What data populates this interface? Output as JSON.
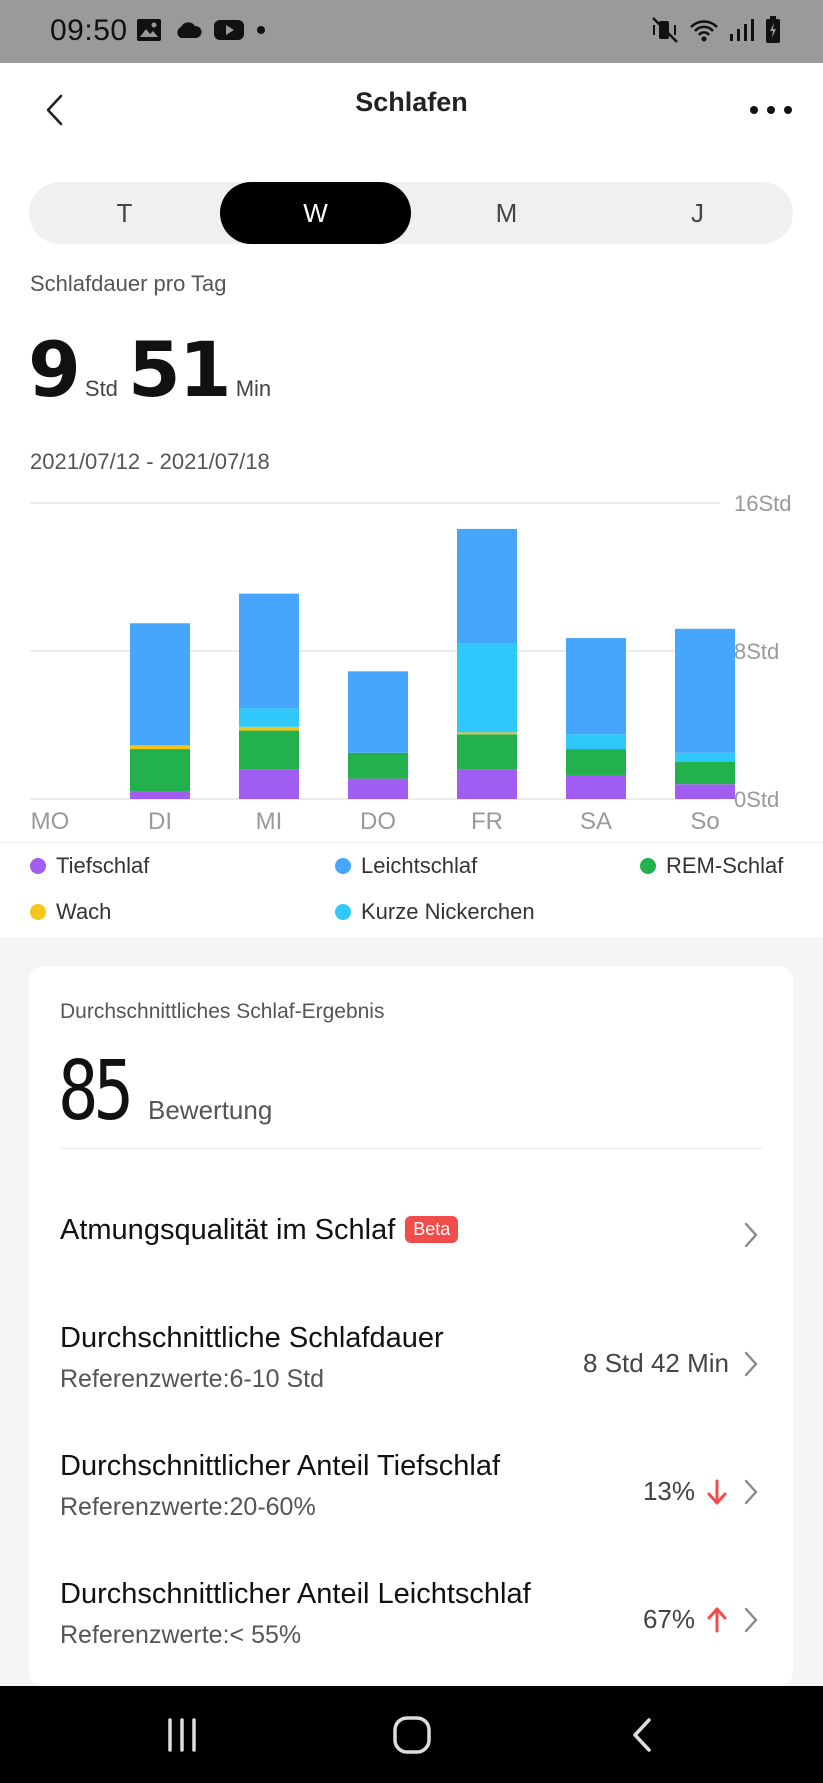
{
  "status_bar": {
    "time": "09:50",
    "left_icons": [
      "image-icon",
      "cloud-icon",
      "youtube-icon",
      "dot-icon"
    ],
    "right_icons": [
      "mute-vibrate-icon",
      "wifi-icon",
      "signal-icon",
      "battery-icon"
    ]
  },
  "header": {
    "title": "Schlafen"
  },
  "segment": {
    "items": [
      "T",
      "W",
      "M",
      "J"
    ],
    "active": "W"
  },
  "summary": {
    "label": "Schlafdauer pro Tag",
    "hours": "9",
    "hours_unit": "Std",
    "minutes": "51",
    "minutes_unit": "Min",
    "date_range": "2021/07/12 - 2021/07/18"
  },
  "chart_data": {
    "type": "bar",
    "stacked": true,
    "categories": [
      "MO",
      "DI",
      "MI",
      "DO",
      "FR",
      "SA",
      "So"
    ],
    "ytick_labels": [
      "16Std",
      "8Std",
      "0Std"
    ],
    "ylim": [
      0,
      16
    ],
    "grid": true,
    "legend_position": "bottom",
    "series": [
      {
        "name": "Tiefschlaf",
        "color": "#a15cf2",
        "values": [
          0,
          0.4,
          1.6,
          1.1,
          1.6,
          1.3,
          0.8
        ]
      },
      {
        "name": "REM-Schlaf",
        "color": "#22b14c",
        "values": [
          0,
          2.3,
          2.1,
          1.4,
          1.9,
          1.4,
          1.2
        ]
      },
      {
        "name": "Wach",
        "color": "#f5c518",
        "values": [
          0,
          0.2,
          0.2,
          0,
          0.1,
          0,
          0
        ]
      },
      {
        "name": "Kurze Nickerchen",
        "color": "#2ec8fa",
        "values": [
          0,
          0,
          1.0,
          0,
          4.8,
          0.8,
          0.5
        ]
      },
      {
        "name": "Leichtschlaf",
        "color": "#46a6fb",
        "values": [
          0,
          6.6,
          6.2,
          4.4,
          6.2,
          5.2,
          6.7
        ]
      }
    ],
    "legend_order": [
      "Tiefschlaf",
      "Leichtschlaf",
      "REM-Schlaf",
      "Wach",
      "Kurze Nickerchen"
    ]
  },
  "card": {
    "label": "Durchschnittliches Schlaf-Ergebnis",
    "score": "85",
    "score_unit": "Bewertung",
    "rows": [
      {
        "title": "Atmungsqualität im Schlaf",
        "badge": "Beta",
        "ref": "",
        "value": ""
      },
      {
        "title": "Durchschnittliche Schlafdauer",
        "ref": "Referenzwerte:6-10 Std",
        "value": "8 Std 42 Min"
      },
      {
        "title": "Durchschnittlicher Anteil Tiefschlaf",
        "ref": "Referenzwerte:20-60%",
        "value": "13%",
        "trend": "down",
        "trend_color": "#f04c4c"
      },
      {
        "title": "Durchschnittlicher Anteil Leichtschlaf",
        "ref": "Referenzwerte:< 55%",
        "value": "67%",
        "trend": "up",
        "trend_color": "#f04c4c"
      }
    ]
  },
  "nav": {
    "icons": [
      "recents-icon",
      "home-icon",
      "back-nav-icon"
    ]
  }
}
